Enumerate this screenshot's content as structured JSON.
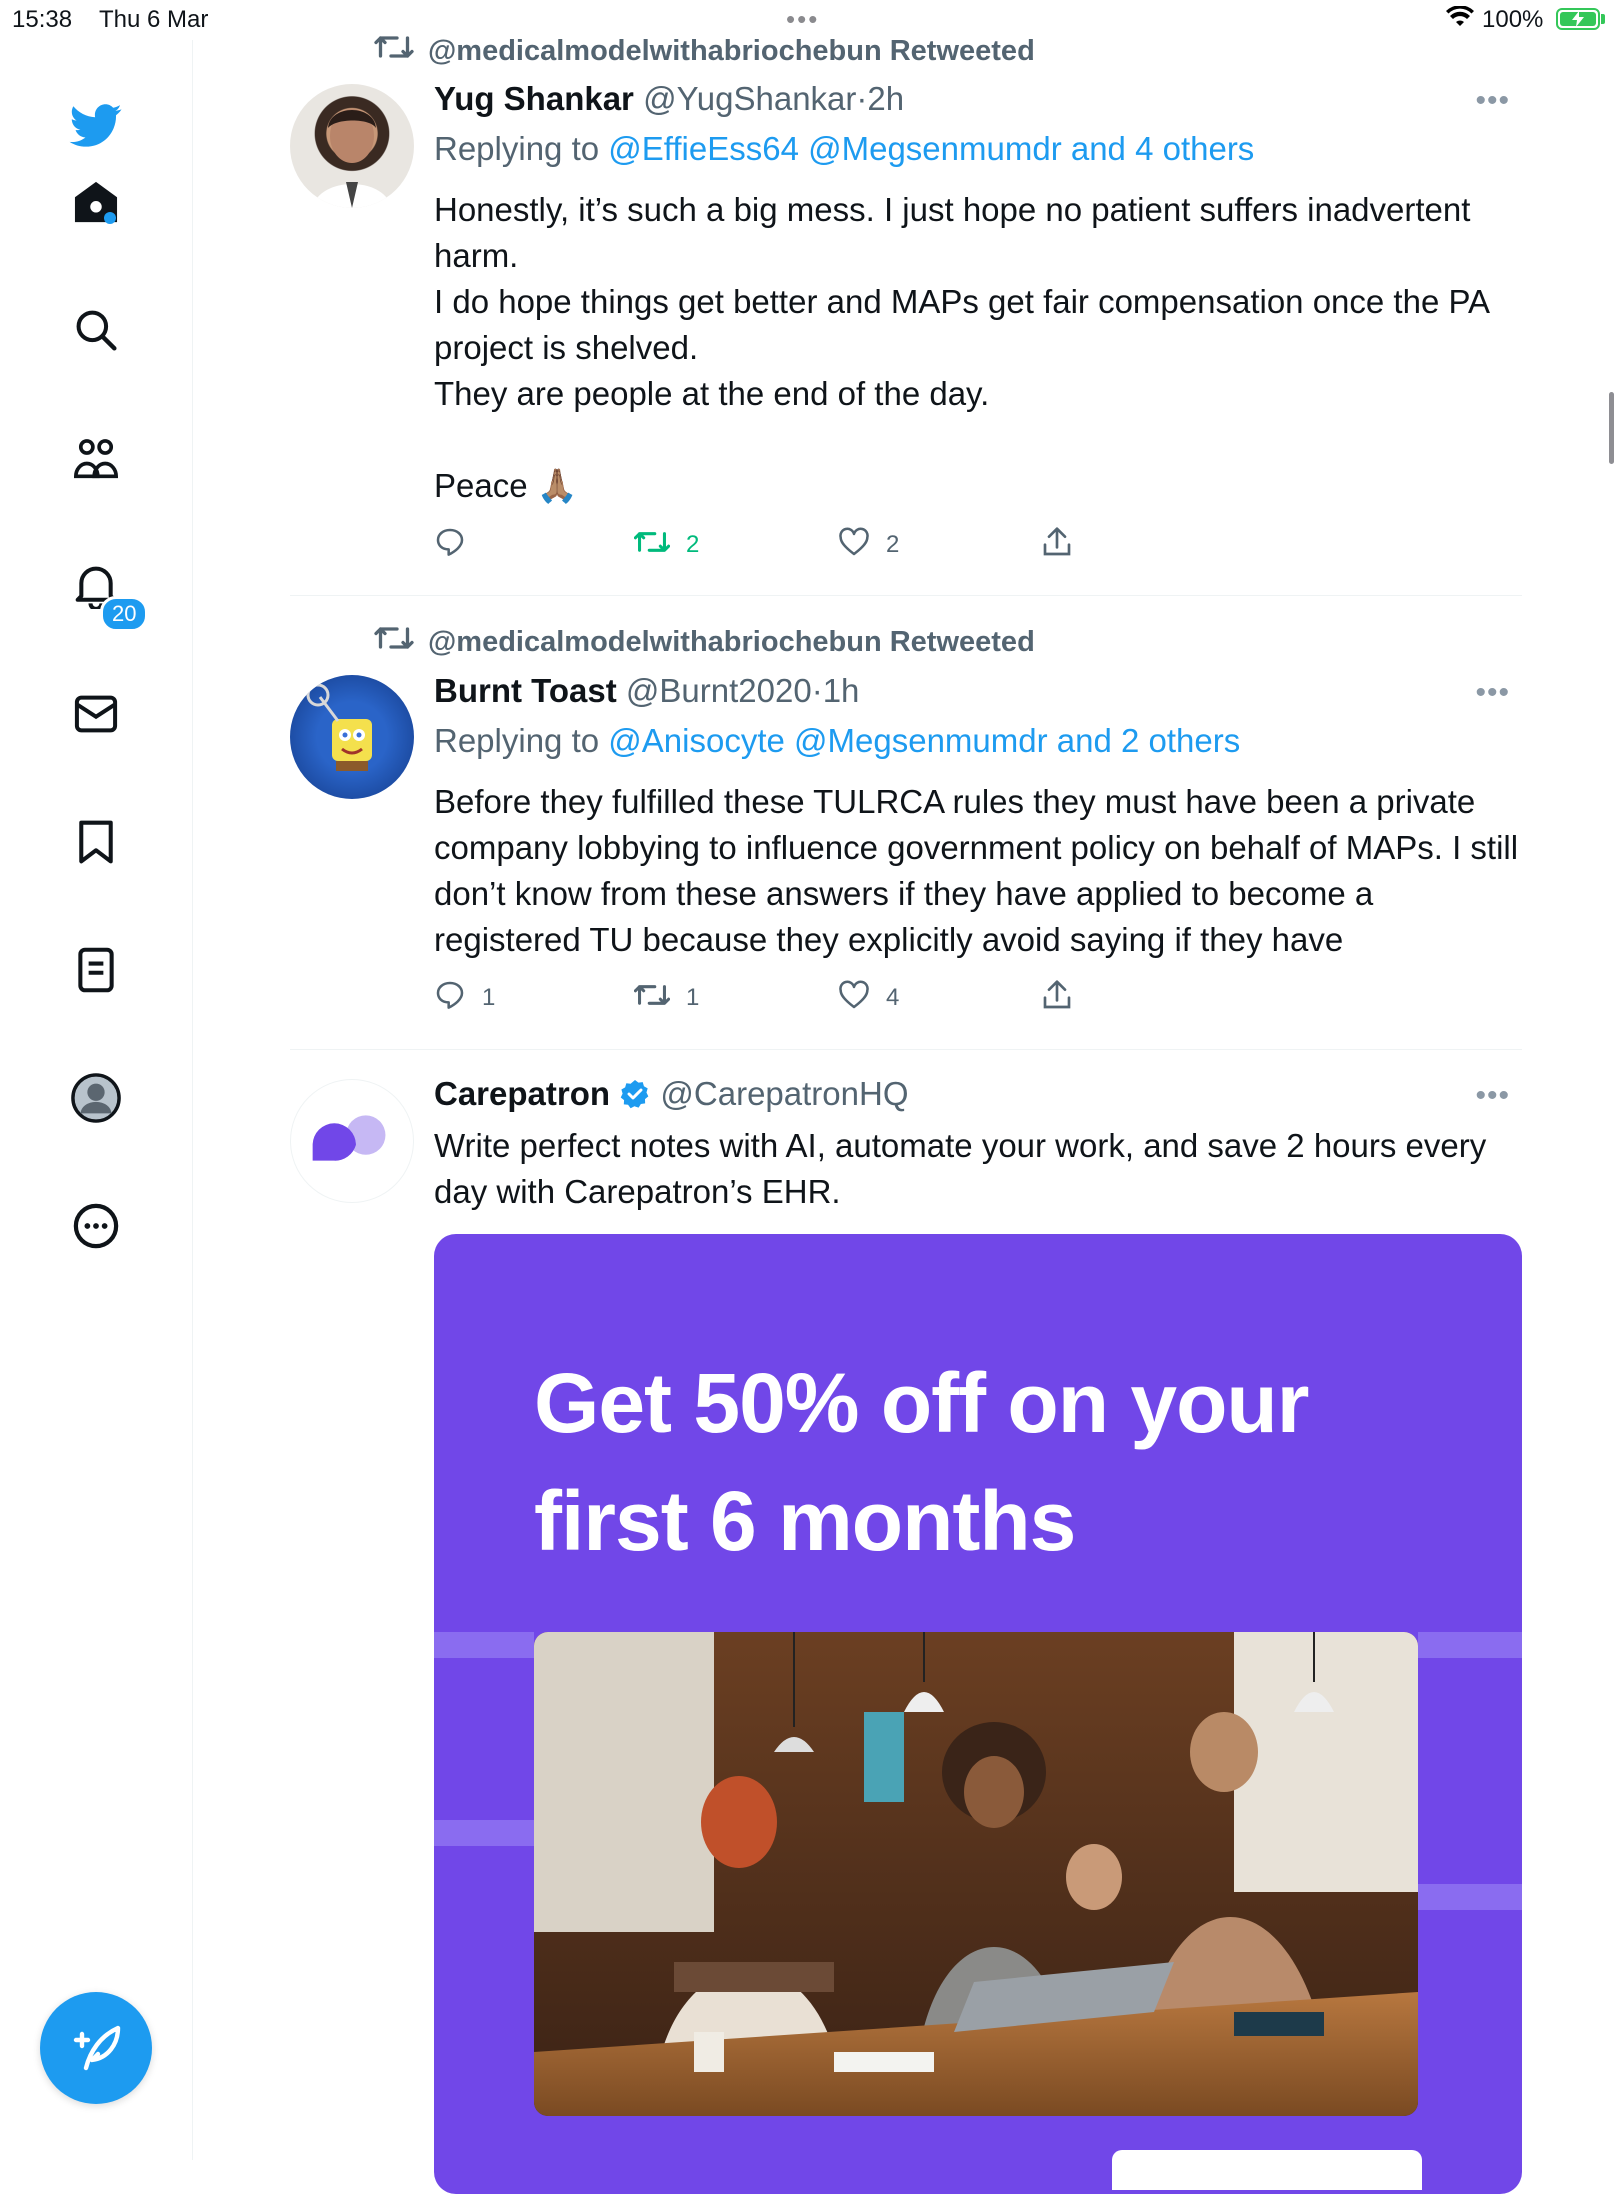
{
  "status_bar": {
    "time": "15:38",
    "date": "Thu 6 Mar",
    "battery_percent": "100%",
    "charging": true
  },
  "sidebar": {
    "items": [
      {
        "name": "home",
        "icon": "home-icon",
        "active": true
      },
      {
        "name": "explore",
        "icon": "search-icon"
      },
      {
        "name": "communities",
        "icon": "communities-icon"
      },
      {
        "name": "notifications",
        "icon": "bell-icon",
        "badge": "20"
      },
      {
        "name": "messages",
        "icon": "mail-icon"
      },
      {
        "name": "bookmarks",
        "icon": "bookmark-icon"
      },
      {
        "name": "lists",
        "icon": "lists-icon"
      },
      {
        "name": "profile",
        "icon": "avatar-icon"
      },
      {
        "name": "more",
        "icon": "more-circle-icon"
      }
    ],
    "compose_icon": "compose-feather-icon"
  },
  "colors": {
    "accent": "#1d9bf0",
    "retweet_active": "#00ba7c",
    "secondary_text": "#536471",
    "ad_purple": "#7147e8"
  },
  "tweets": [
    {
      "retweeted_by": "@medicalmodelwithabriochebun Retweeted",
      "name": "Yug Shankar",
      "handle": "@YugShankar",
      "dot": "·",
      "time": "2h",
      "replying_prefix": "Replying to",
      "replying_to": "@EffieEss64 @Megsenmumdr and 4 others",
      "text": "Honestly, it’s such a big mess. I just hope no patient suffers inadvertent harm.\nI do hope things get better and MAPs get fair compensation once the PA project is shelved.\nThey are people at the end of the day.\n\nPeace 🙏🏽",
      "reply_count": "",
      "retweet_count": "2",
      "like_count": "2",
      "retweeted": true
    },
    {
      "retweeted_by": "@medicalmodelwithabriochebun Retweeted",
      "name": "Burnt Toast",
      "handle": "@Burnt2020",
      "dot": "·",
      "time": "1h",
      "replying_prefix": "Replying to",
      "replying_to": "@Anisocyte @Megsenmumdr and 2 others",
      "text": "Before they fulfilled these TULRCA rules they must have been a private company lobbying to influence government policy on behalf of MAPs. I still don’t know from these answers if they have applied to become a registered TU because they explicitly avoid saying if they have",
      "reply_count": "1",
      "retweet_count": "1",
      "like_count": "4",
      "retweeted": false
    },
    {
      "name": "Carepatron",
      "verified": true,
      "handle": "@CarepatronHQ",
      "text": "Write perfect notes with AI, automate your work, and save 2 hours every day with Carepatron’s EHR.",
      "ad_headline": "Get 50% off on your first 6 months"
    }
  ]
}
